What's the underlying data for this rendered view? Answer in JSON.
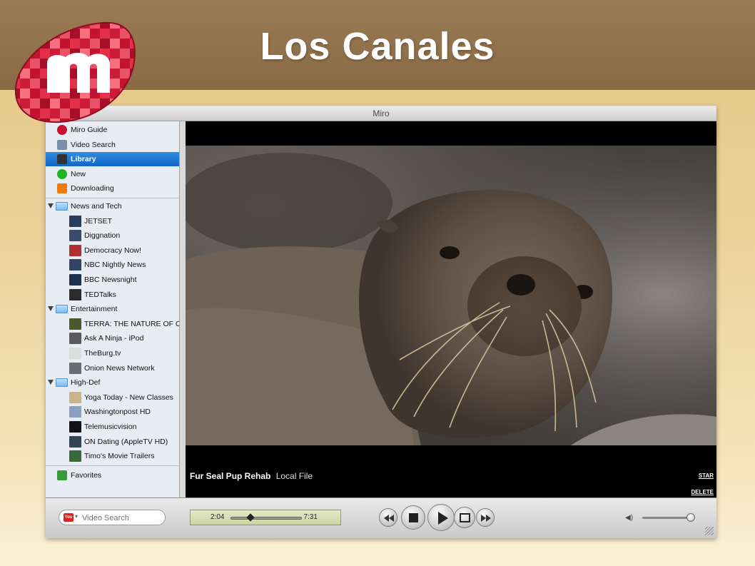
{
  "slide": {
    "title": "Los Canales"
  },
  "window": {
    "title": "Miro"
  },
  "sidebar": {
    "top_items": [
      {
        "label": "Miro Guide",
        "icon": "miro-guide-icon",
        "color": "#c8102e"
      },
      {
        "label": "Video Search",
        "icon": "magnifier-icon",
        "color": "#7a8fa6"
      },
      {
        "label": "Library",
        "icon": "film-library-icon",
        "color": "#333333",
        "selected": true
      },
      {
        "label": "New",
        "icon": "green-dot-icon",
        "color": "#1fb51f"
      },
      {
        "label": "Downloading",
        "icon": "download-arrow-icon",
        "color": "#f07a10"
      }
    ],
    "folders": [
      {
        "label": "News and Tech",
        "channels": [
          "JETSET",
          "Diggnation",
          "Democracy Now!",
          "NBC Nightly News",
          "BBC Newsnight",
          "TEDTalks"
        ]
      },
      {
        "label": "Entertainment",
        "channels": [
          "TERRA: THE NATURE OF O",
          "Ask A Ninja - iPod",
          "TheBurg.tv",
          "Onion News Network"
        ]
      },
      {
        "label": "High-Def",
        "channels": [
          "Yoga Today - New Classes",
          "Washingtonpost HD",
          "Telemusicvision",
          "ON Dating (AppleTV HD)",
          "Timo's Movie Trailers"
        ]
      }
    ],
    "favorites": {
      "label": "Favorites",
      "icon": "favorites-icon"
    }
  },
  "video": {
    "title": "Fur Seal Pup Rehab",
    "source": "Local File",
    "star_label": "STAR",
    "delete_label": "DELETE"
  },
  "controls": {
    "search_placeholder": "Video Search",
    "search_engine_icon": "youtube-icon",
    "current_time": "2:04",
    "total_time": "7:31",
    "progress_fraction": 0.28,
    "volume_fraction": 0.95,
    "buttons": [
      "skip-back-button",
      "stop-button",
      "play-button",
      "fullscreen-button",
      "skip-forward-button"
    ]
  },
  "colors": {
    "header_band": "#8a6a45",
    "selection": "#1a70cc",
    "sidebar_bg": "#e8edf5"
  }
}
